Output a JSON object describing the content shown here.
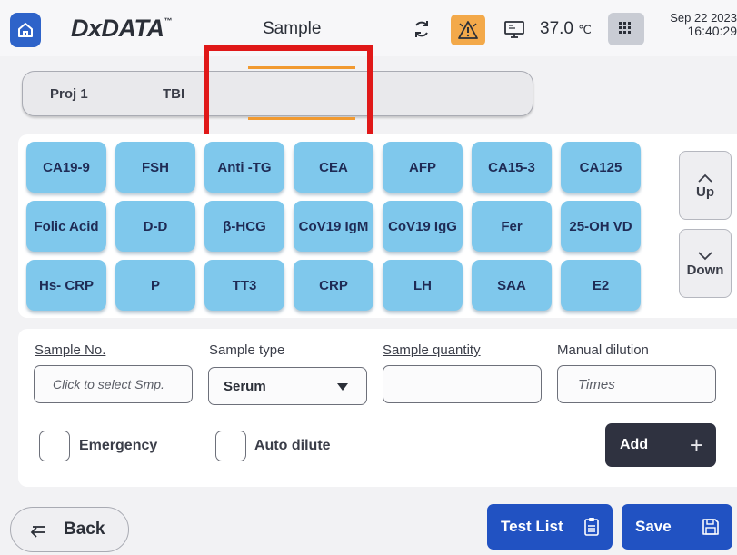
{
  "header": {
    "brand": "DxDATA",
    "brand_tm": "™",
    "title": "Sample",
    "temperature": "37.0",
    "temperature_unit": "℃",
    "date": "Sep 22 2023",
    "time": "16:40:29"
  },
  "projects": {
    "tabs": [
      {
        "label": "Proj 1"
      },
      {
        "label": "TBI"
      },
      {
        "label": ""
      }
    ],
    "active_color": "#f19a31",
    "highlight_color": "#e01818"
  },
  "tests": {
    "rows": [
      [
        "CA19-9",
        "FSH",
        "Anti  -TG",
        "CEA",
        "AFP",
        "CA15-3",
        "CA125"
      ],
      [
        "Folic Acid",
        "D-D",
        "β-HCG",
        "CoV19 IgM",
        "CoV19 IgG",
        "Fer",
        "25-OH VD"
      ],
      [
        "Hs- CRP",
        "P",
        "TT3",
        "CRP",
        "LH",
        "SAA",
        "E2"
      ]
    ],
    "up_label": "Up",
    "down_label": "Down",
    "button_color": "#7fc8ec"
  },
  "form": {
    "sample_no_label": "Sample No.",
    "sample_no_placeholder": "Click to select Smp.",
    "sample_type_label": "Sample type",
    "sample_type_value": "Serum",
    "sample_quantity_label": "Sample quantity",
    "sample_quantity_value": "",
    "manual_dilution_label": "Manual dilution",
    "manual_dilution_placeholder": "Times",
    "emergency_label": "Emergency",
    "auto_dilute_label": "Auto dilute",
    "add_label": "Add"
  },
  "footer": {
    "back_label": "Back",
    "test_list_label": "Test List",
    "save_label": "Save",
    "accent": "#2152c2"
  },
  "icons": [
    "home-icon",
    "refresh-icon",
    "alarm-icon",
    "monitor-icon",
    "keypad-icon",
    "chevron-up-icon",
    "chevron-down-icon",
    "dropdown-arrow-icon",
    "plus-icon",
    "back-arrow-icon",
    "clipboard-icon",
    "save-icon"
  ]
}
